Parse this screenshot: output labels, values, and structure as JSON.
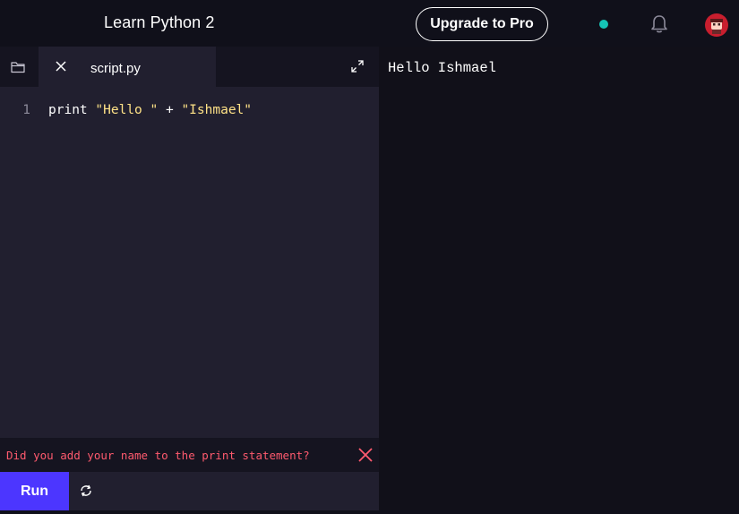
{
  "header": {
    "course_title": "Learn Python 2",
    "upgrade_label": "Upgrade to Pro",
    "status_color": "#15c4b6",
    "bell_icon": "bell-icon",
    "avatar_icon": "user-avatar"
  },
  "editor": {
    "folder_icon": "folder-icon",
    "tab": {
      "close_icon": "close-icon",
      "file_name": "script.py"
    },
    "expand_icon": "expand-icon",
    "lines": [
      {
        "number": "1",
        "tokens": {
          "keyword": "print",
          "string1": "\"Hello \"",
          "operator": "+",
          "string2": "\"Ishmael\""
        }
      }
    ],
    "string_color": "#ffe287"
  },
  "feedback": {
    "message": "Did you add your name to the print statement?",
    "close_icon": "close-icon",
    "color": "#ff5a6e"
  },
  "run_bar": {
    "run_label": "Run",
    "reset_icon": "refresh-icon",
    "accent_color": "#4c36ff"
  },
  "output": {
    "text": "Hello Ishmael"
  }
}
